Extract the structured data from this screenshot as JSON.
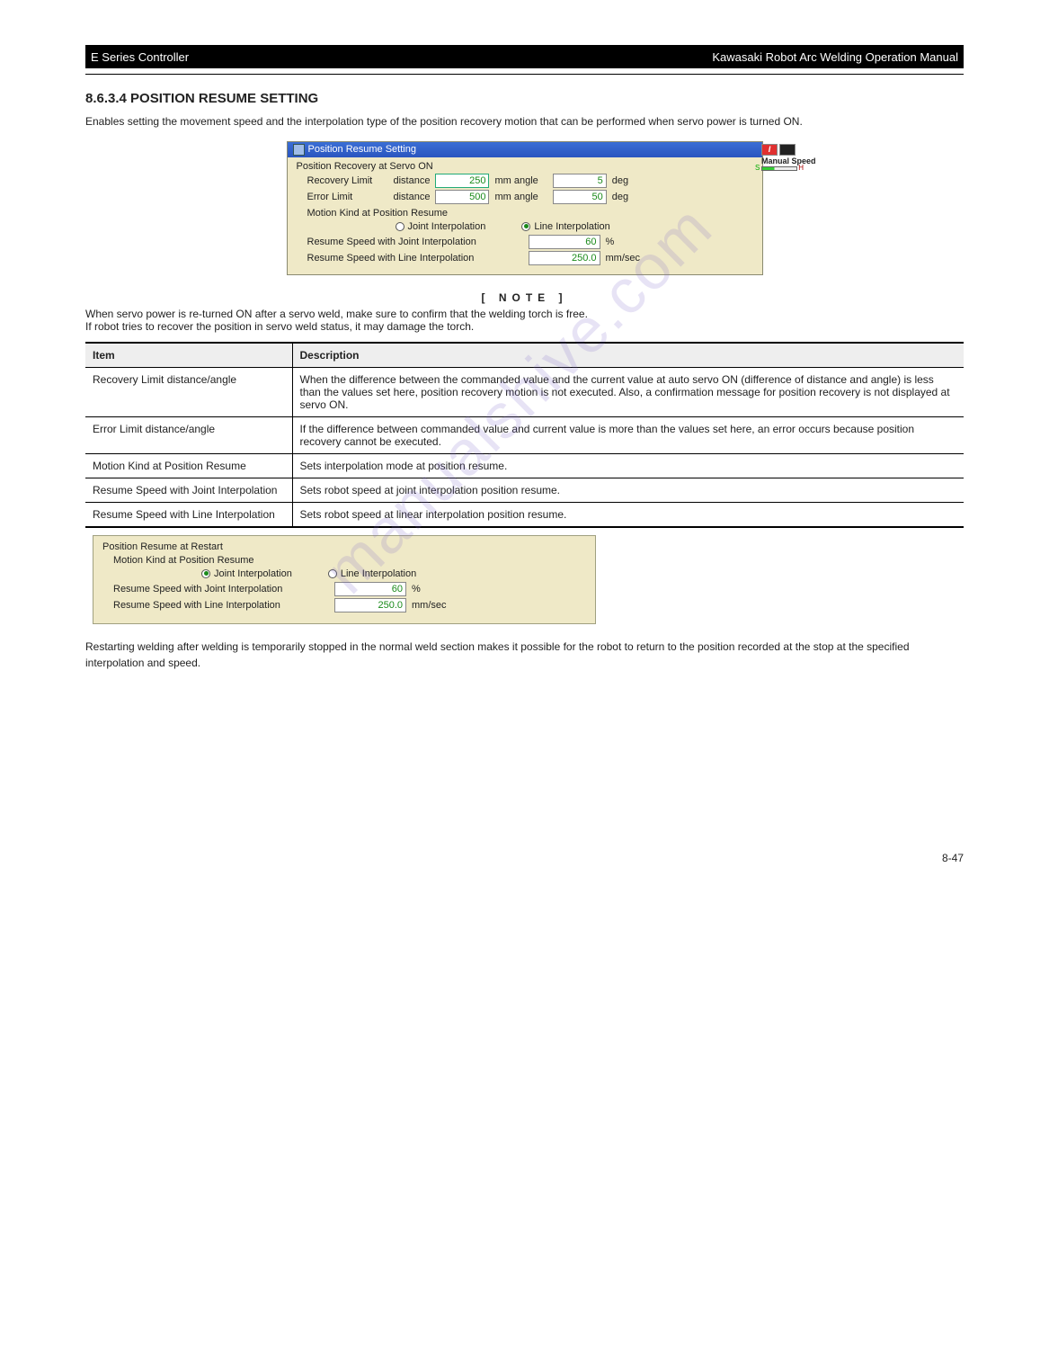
{
  "header": {
    "left": "E Series Controller",
    "right": "Kawasaki Robot Arc Welding Operation Manual"
  },
  "section_number": "8.6.3.4 POSITION RESUME SETTING",
  "intro": "Enables setting the movement speed and the interpolation type of the position recovery motion that can be performed when servo power is turned ON.",
  "win": {
    "title": "Position Resume Setting",
    "heading1": "Position Recovery at Servo ON",
    "recovery_limit_label": "Recovery Limit",
    "error_limit_label": "Error Limit",
    "distance_label": "distance",
    "recovery_distance_value": "250",
    "error_distance_value": "500",
    "mm_angle": "mm angle",
    "recovery_angle_value": "5",
    "error_angle_value": "50",
    "deg": "deg",
    "motion_kind_label": "Motion Kind at Position Resume",
    "joint_label": "Joint Interpolation",
    "line_label": "Line Interpolation",
    "resume_joint_label": "Resume Speed with Joint Interpolation",
    "resume_joint_value": "60",
    "percent": "%",
    "resume_line_label": "Resume Speed with Line Interpolation",
    "resume_line_value": "250.0",
    "mmsec": "mm/sec",
    "badge_i": "I",
    "badge_label": "Manual Speed",
    "badge_s": "S",
    "badge_h": "H"
  },
  "note": {
    "label": "[  NOTE  ]",
    "text1": "When servo power is re-turned ON after a servo weld, make sure to confirm that the welding torch is free.",
    "text2": "If robot tries to recover the position in servo weld status, it may damage the torch."
  },
  "table": {
    "h1": "Item",
    "h2": "Description",
    "rows": [
      {
        "item": "Recovery Limit distance/angle",
        "desc": "When the difference between the commanded value and the current value at auto servo ON (difference of distance and angle) is less than the values set here, position recovery motion is not executed. Also, a confirmation message for position recovery is not displayed at servo ON."
      },
      {
        "item": "Error Limit distance/angle",
        "desc": "If the difference between commanded value and current value is more than the values set here, an error occurs because position recovery cannot be executed."
      },
      {
        "item": "Motion Kind at Position Resume",
        "desc": "Sets interpolation mode at position resume."
      },
      {
        "item": "Resume Speed with Joint Interpolation",
        "desc": "Sets robot speed at joint interpolation position resume."
      },
      {
        "item": "Resume Speed with Line Interpolation",
        "desc": "Sets robot speed at linear interpolation position resume."
      }
    ]
  },
  "panel2": {
    "heading": "Position Resume at Restart",
    "motion_kind_label": "Motion Kind at Position Resume",
    "joint_label": "Joint Interpolation",
    "line_label": "Line Interpolation",
    "resume_joint_label": "Resume Speed with Joint Interpolation",
    "resume_joint_value": "60",
    "percent": "%",
    "resume_line_label": "Resume Speed with Line Interpolation",
    "resume_line_value": "250.0",
    "mmsec": "mm/sec"
  },
  "after_panel2": "Restarting welding after welding is temporarily stopped in the normal weld section makes it possible for the robot to return to the position recorded at the stop at the specified interpolation and speed.",
  "footer": "8-47",
  "watermark": "manualshive.com"
}
